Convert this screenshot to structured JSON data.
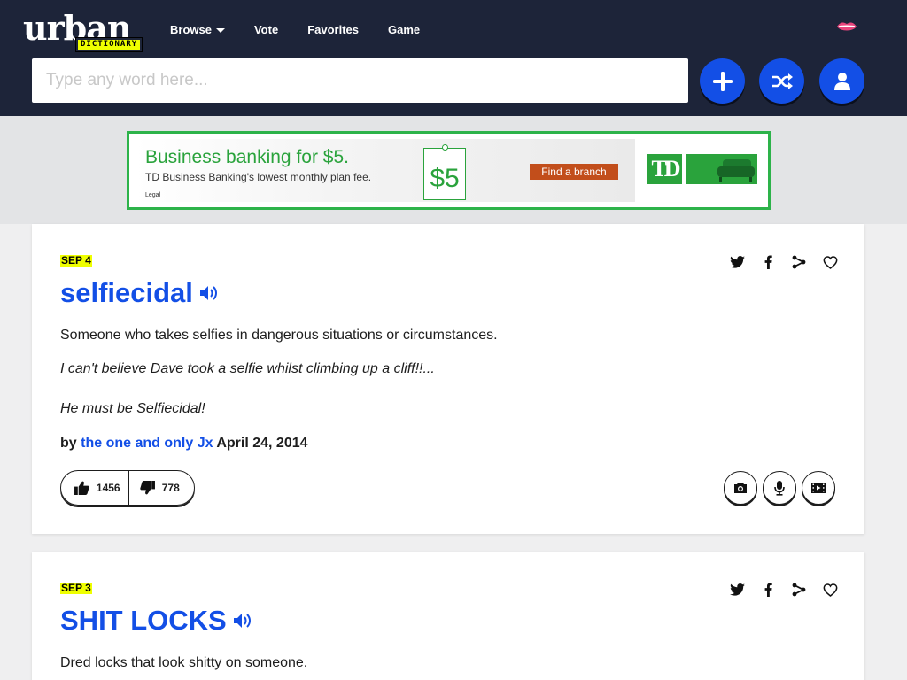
{
  "header": {
    "logo": {
      "word": "urban",
      "sub": "DICTIONARY"
    },
    "nav": [
      {
        "label": "Browse",
        "dropdown": true
      },
      {
        "label": "Vote"
      },
      {
        "label": "Favorites"
      },
      {
        "label": "Game"
      }
    ],
    "search": {
      "placeholder": "Type any word here...",
      "value": ""
    },
    "buttons": [
      {
        "name": "add-definition-button",
        "icon": "plus-icon"
      },
      {
        "name": "random-button",
        "icon": "shuffle-icon"
      },
      {
        "name": "account-button",
        "icon": "user-icon"
      }
    ],
    "colors": {
      "header_bg": "#1d2439",
      "accent": "#134fe6",
      "highlight": "#efff00"
    }
  },
  "ad": {
    "title": "Business banking for $5.",
    "subtitle": "TD Business Banking's lowest monthly plan fee.",
    "legal": "Legal",
    "price_tag": "$5",
    "cta": "Find a branch",
    "brand": "TD",
    "colors": {
      "border": "#2db34a",
      "cta": "#c24e1b"
    }
  },
  "entries": [
    {
      "date": "SEP 4",
      "word": "selfiecidal",
      "meaning": "Someone who takes selfies in dangerous situations or circumstances.",
      "examples": [
        "I can't believe Dave took a selfie whilst climbing up a cliff!!...",
        "He must be Selfiecidal!"
      ],
      "by_prefix": "by",
      "author": "the one and only Jx",
      "posted": "April 24, 2014",
      "upvotes": "1456",
      "downvotes": "778"
    },
    {
      "date": "SEP 3",
      "word": "SHIT LOCKS",
      "meaning": "Dred locks that look shitty on someone."
    }
  ]
}
